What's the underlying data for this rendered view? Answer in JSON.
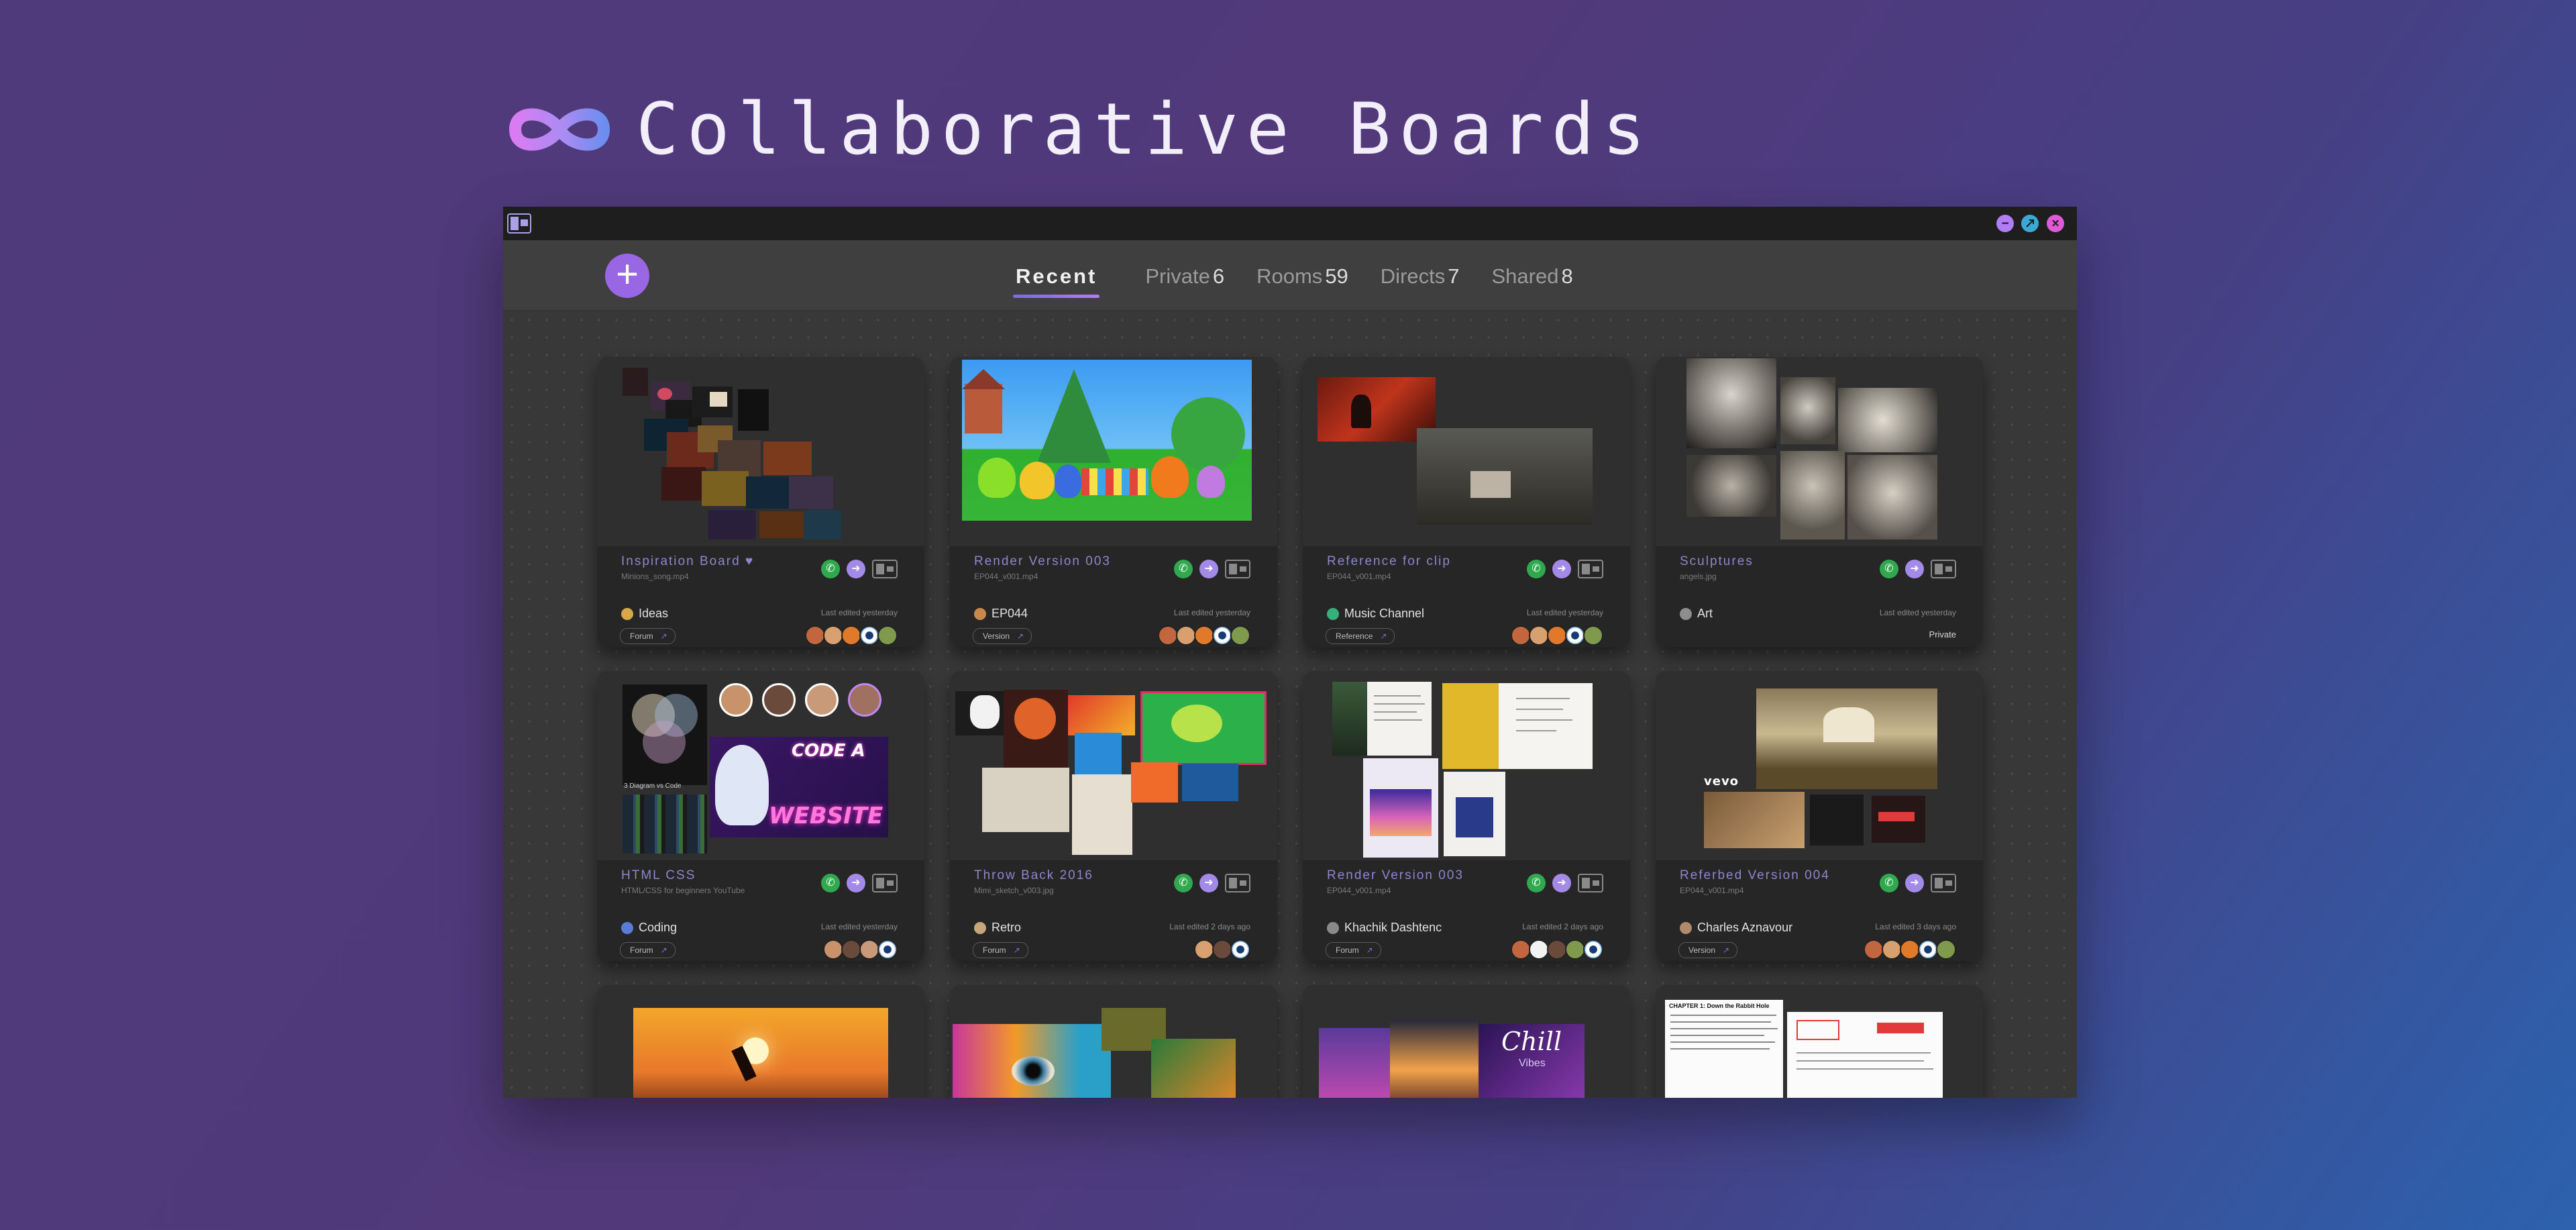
{
  "header": {
    "title": "Collaborative Boards",
    "logo_icon": "infinity-icon"
  },
  "window": {
    "controls": [
      "minimize",
      "maximize",
      "close"
    ],
    "control_colors": {
      "minimize": "#b27cf5",
      "maximize": "#3ba8d6",
      "close": "#e05ad8"
    }
  },
  "toolbar": {
    "add_label": "+",
    "tabs": [
      {
        "label": "Recent",
        "count": ""
      },
      {
        "label": "Private",
        "count": "6"
      },
      {
        "label": "Rooms",
        "count": "59"
      },
      {
        "label": "Directs",
        "count": "7"
      },
      {
        "label": "Shared",
        "count": "8"
      }
    ]
  },
  "colors": {
    "accent": "#9a67e4",
    "call": "#2fa84e",
    "card": "#2b2b2b",
    "title": "#8e86cf"
  },
  "boards": [
    {
      "title": "Inspiration Board ♥",
      "file": "Minions_song.mp4",
      "group": "Ideas",
      "group_color": "#d9a845",
      "tag": "Forum",
      "edited": "Last edited yesterday",
      "avatar_count": 5
    },
    {
      "title": "Render Version 003",
      "file": "EP044_v001.mp4",
      "group": "EP044",
      "group_color": "#c88a4a",
      "tag": "Version",
      "edited": "Last edited yesterday",
      "avatar_count": 5
    },
    {
      "title": "Reference for clip",
      "file": "EP044_v001.mp4",
      "group": "Music Channel",
      "group_color": "#38b07a",
      "tag": "Reference",
      "edited": "Last edited yesterday",
      "avatar_count": 5
    },
    {
      "title": "Sculptures",
      "file": "angels.jpg",
      "group": "Art",
      "group_color": "#8d8d8d",
      "tag": "",
      "edited": "Last edited yesterday",
      "private_label": "Private",
      "avatar_count": 0
    },
    {
      "title": "HTML CSS",
      "file": "HTML/CSS for beginners YouTube",
      "group": "Coding",
      "group_color": "#5a7cd8",
      "tag": "Forum",
      "edited": "Last edited yesterday",
      "avatar_count": 4
    },
    {
      "title": "Throw Back 2016",
      "file": "Mimi_sketch_v003.jpg",
      "group": "Retro",
      "group_color": "#c9a57a",
      "tag": "Forum",
      "edited": "Last edited 2 days ago",
      "avatar_count": 3
    },
    {
      "title": "Render Version 003",
      "file": "EP044_v001.mp4",
      "group": "Khachik Dashtenc",
      "group_color": "#8a8a8a",
      "tag": "Forum",
      "edited": "Last edited 2 days ago",
      "avatar_count": 5
    },
    {
      "title": "Referbed Version 004",
      "file": "EP044_v001.mp4",
      "group": "Charles Aznavour",
      "group_color": "#b08a6a",
      "tag": "Version",
      "edited": "Last edited 3 days ago",
      "avatar_count": 5
    }
  ],
  "thumbnail_text": {
    "code_a": "CODE A",
    "website": "WEBSITE",
    "venn_caption": "3 Diagram vs Code",
    "chill": "Chill",
    "vibes": "Vibes",
    "vevo": "vevo",
    "chapter": "CHAPTER 1: Down the Rabbit Hole"
  }
}
